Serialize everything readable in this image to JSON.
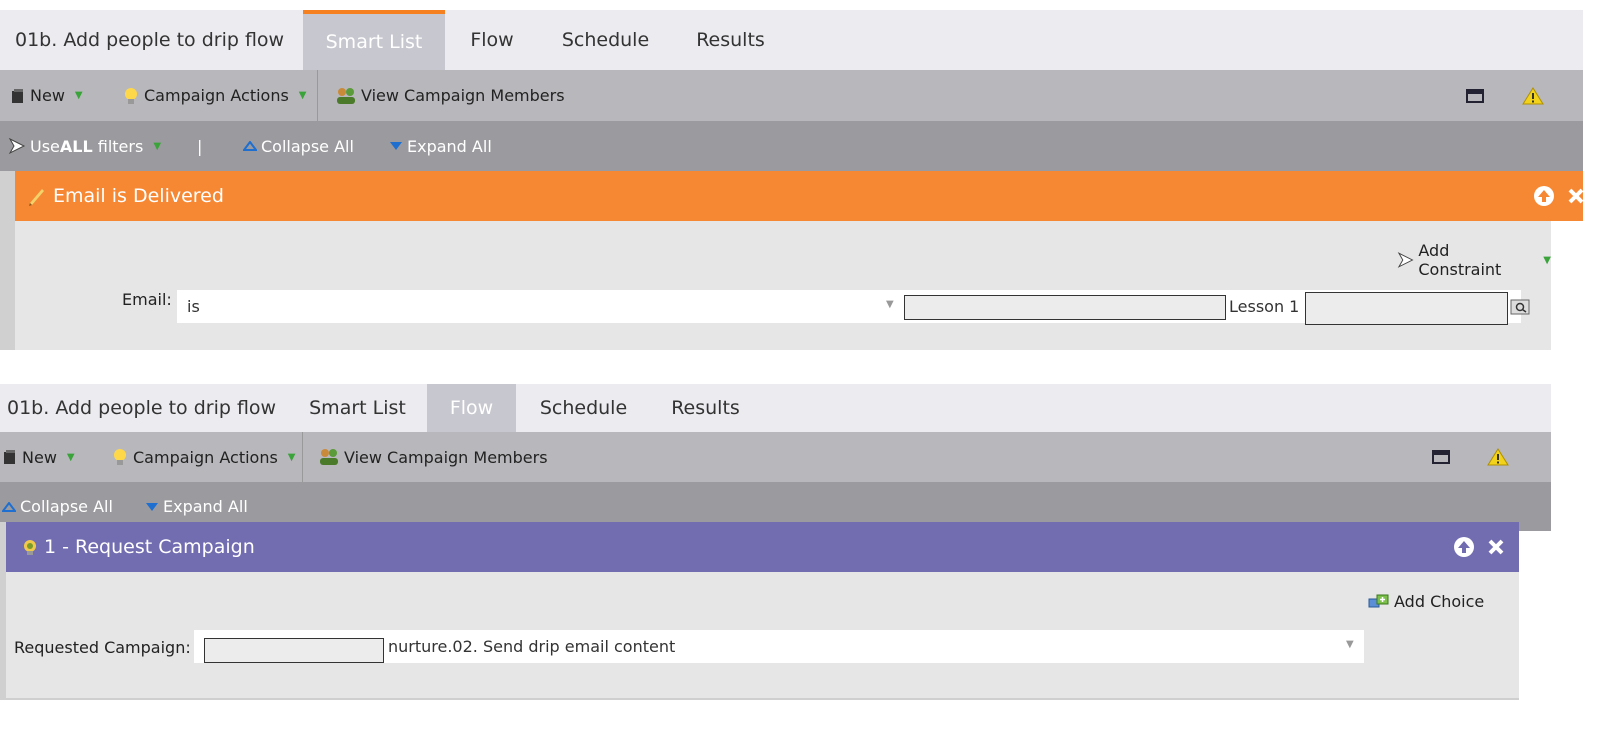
{
  "panel1": {
    "tabs": {
      "title": "01b. Add people to drip flow",
      "smart_list": "Smart List",
      "flow": "Flow",
      "schedule": "Schedule",
      "results": "Results",
      "active": "Smart List"
    },
    "toolbar": {
      "new_label": "New",
      "campaign_actions_label": "Campaign Actions",
      "view_members_label": "View Campaign Members"
    },
    "filterbar": {
      "use_prefix": "Use ",
      "use_bold": "ALL",
      "use_suffix": " filters",
      "separator": "|",
      "collapse_all": "Collapse All",
      "expand_all": "Expand All"
    },
    "filter": {
      "title": "Email is Delivered",
      "add_constraint": "Add Constraint",
      "field_label": "Email:",
      "operator": "is",
      "value_suffix": "Lesson 1"
    }
  },
  "panel2": {
    "tabs": {
      "title": "01b. Add people to drip flow",
      "smart_list": "Smart List",
      "flow": "Flow",
      "schedule": "Schedule",
      "results": "Results",
      "active": "Flow"
    },
    "toolbar": {
      "new_label": "New",
      "campaign_actions_label": "Campaign Actions",
      "view_members_label": "View Campaign Members"
    },
    "filterbar": {
      "collapse_all": "Collapse All",
      "expand_all": "Expand All"
    },
    "flow_step": {
      "title": "1 - Request Campaign",
      "add_choice": "Add Choice",
      "field_label": "Requested Campaign:",
      "value_suffix": "nurture.02. Send drip email content"
    }
  },
  "colors": {
    "smart_list_accent": "#f4801f",
    "filter_header": "#f68733",
    "flow_header": "#726db1",
    "toolbar": "#b8b8bc",
    "filterbar": "#9b9b9f"
  }
}
